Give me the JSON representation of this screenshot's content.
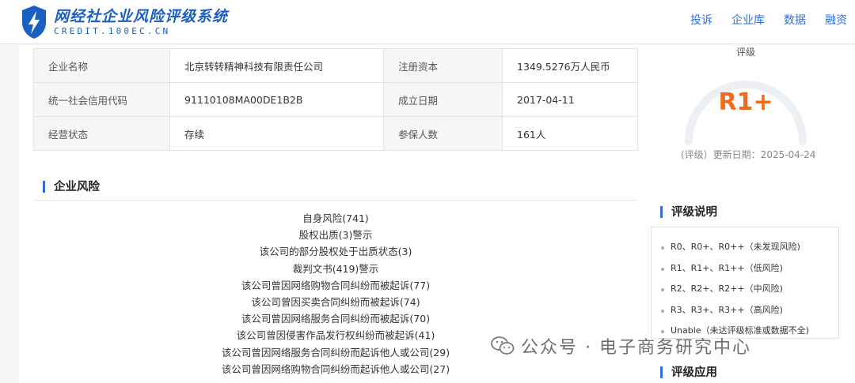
{
  "header": {
    "logo_title": "网经社企业风险评级系统",
    "logo_sub": "CREDIT.100EC.CN",
    "nav": [
      "投诉",
      "企业库",
      "数据",
      "融资"
    ]
  },
  "company_info": {
    "rows": [
      {
        "k1": "企业名称",
        "v1": "北京转转精神科技有限责任公司",
        "k2": "注册资本",
        "v2": "1349.5276万人民币"
      },
      {
        "k1": "统一社会信用代码",
        "v1": "91110108MA00DE1B2B",
        "k2": "成立日期",
        "v2": "2017-04-11"
      },
      {
        "k1": "经营状态",
        "v1": "存续",
        "k2": "参保人数",
        "v2": "161人"
      }
    ]
  },
  "risk": {
    "title": "企业风险",
    "items": [
      "自身风险(741)",
      "股权出质(3)警示",
      "该公司的部分股权处于出质状态(3)",
      "裁判文书(419)警示",
      "该公司曾因网络购物合同纠纷而被起诉(77)",
      "该公司曾因买卖合同纠纷而被起诉(74)",
      "该公司曾因网络服务合同纠纷而被起诉(70)",
      "该公司曾因侵害作品发行权纠纷而被起诉(41)",
      "该公司曾因网络服务合同纠纷而起诉他人或公司(29)",
      "该公司曾因网络购物合同纠纷而起诉他人或公司(27)"
    ]
  },
  "rating": {
    "label": "评级",
    "value": "R1+",
    "date_text": "(评级）更新日期：2025-04-24",
    "accent": "#f26a1b"
  },
  "explain": {
    "title": "评级说明",
    "items": [
      "R0、R0+、R0++（未发现风险)",
      "R1、R1+、R1++（低风险)",
      "R2、R2+、R2++（中风险)",
      "R3、R3+、R3++（高风险)",
      "Unable（未达评级标准或数据不全)"
    ]
  },
  "apply": {
    "title": "评级应用"
  },
  "watermark": {
    "text": "公众号 · 电子商务研究中心"
  }
}
